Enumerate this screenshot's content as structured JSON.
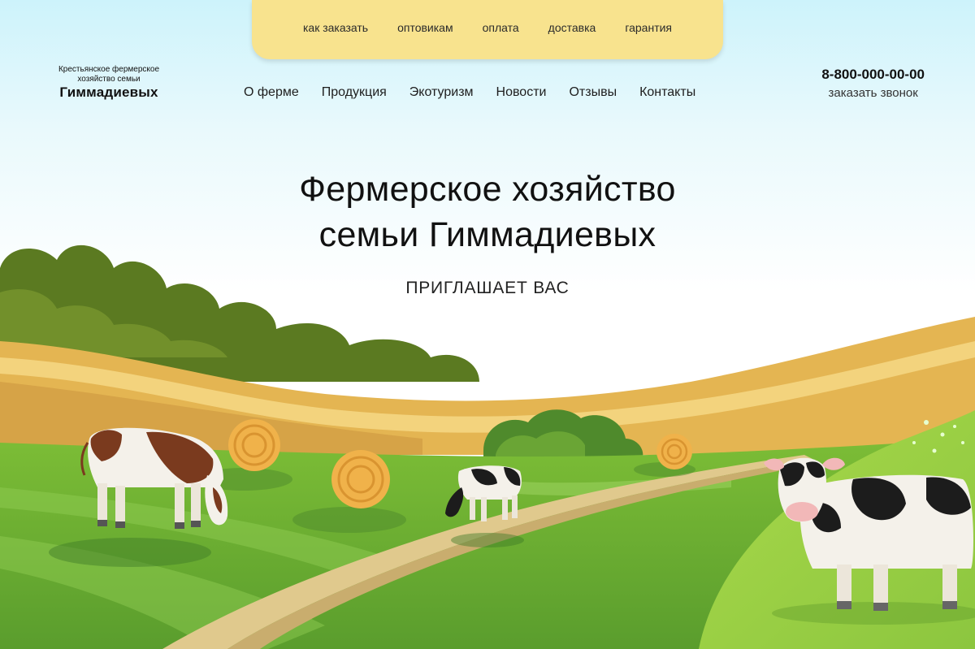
{
  "top_menu": [
    "как заказать",
    "оптовикам",
    "оплата",
    "доставка",
    "гарантия"
  ],
  "logo": {
    "line1": "Крестьянское фермерское",
    "line2": "хозяйство семьи",
    "line3": "Гиммадиевых"
  },
  "nav": [
    "О ферме",
    "Продукция",
    "Экотуризм",
    "Новости",
    "Отзывы",
    "Контакты"
  ],
  "contact": {
    "phone": "8-800-000-00-00",
    "callback": "заказать звонок"
  },
  "hero": {
    "title_line1": "Фермерское хозяйство",
    "title_line2": "семьи Гиммадиевых",
    "subtitle": "ПРИГЛАШАЕТ ВАС"
  },
  "colors": {
    "menu_bg": "#f8e38e",
    "sky": "#cdf3fb",
    "grass": "#8cc63f",
    "dark_green": "#5a7d1f",
    "field": "#e3b453",
    "hay": "#f0b24a"
  }
}
